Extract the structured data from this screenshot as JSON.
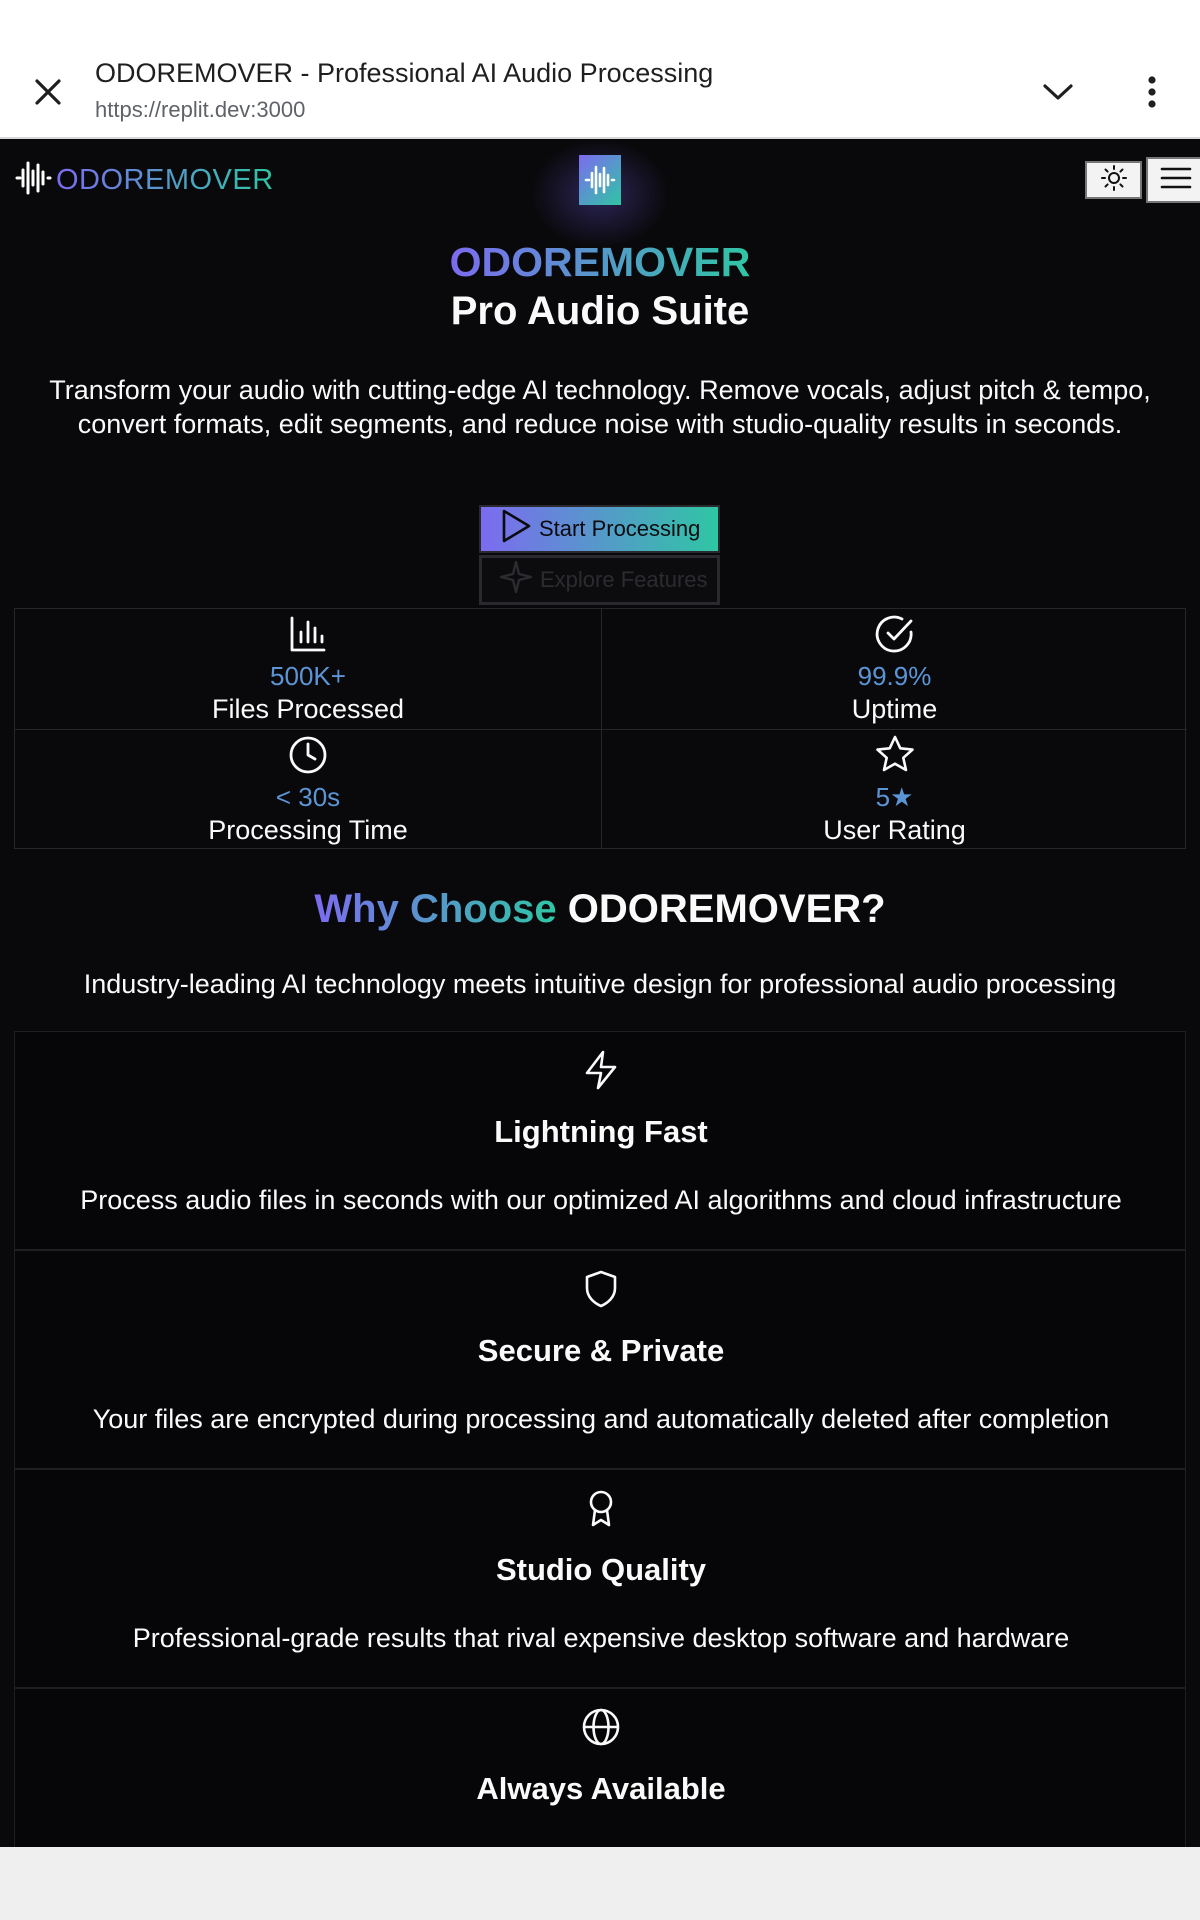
{
  "browser": {
    "title": "ODOREMOVER - Professional AI Audio Processing",
    "url": "https://replit.dev:3000"
  },
  "header": {
    "brand": "ODOREMOVER"
  },
  "hero": {
    "brand": "ODOREMOVER",
    "subtitle": "Pro Audio Suite",
    "description": "Transform your audio with cutting-edge AI technology. Remove vocals, adjust pitch & tempo, convert formats, edit segments, and reduce noise with studio-quality results in seconds.",
    "start_label": "Start Processing",
    "explore_label": "Explore Features"
  },
  "stats": [
    {
      "icon": "bar-chart-icon",
      "value": "500K+",
      "label": "Files Processed"
    },
    {
      "icon": "check-circle-icon",
      "value": "99.9%",
      "label": "Uptime"
    },
    {
      "icon": "clock-icon",
      "value": "< 30s",
      "label": "Processing Time"
    },
    {
      "icon": "star-icon",
      "value": "5★",
      "label": "User Rating"
    }
  ],
  "why": {
    "title_part1": "Why Choose",
    "title_part2": "ODOREMOVER?",
    "subtitle": "Industry-leading AI technology meets intuitive design for professional audio processing"
  },
  "features": [
    {
      "icon": "lightning-icon",
      "title": "Lightning Fast",
      "description": "Process audio files in seconds with our optimized AI algorithms and cloud infrastructure"
    },
    {
      "icon": "shield-icon",
      "title": "Secure & Private",
      "description": "Your files are encrypted during processing and automatically deleted after completion"
    },
    {
      "icon": "award-icon",
      "title": "Studio Quality",
      "description": "Professional-grade results that rival expensive desktop software and hardware"
    },
    {
      "icon": "globe-icon",
      "title": "Always Available",
      "description": ""
    }
  ],
  "colors": {
    "accent_start": "#7c6bf0",
    "accent_end": "#2fc6a4",
    "stat_value": "#5b95d6",
    "background": "#09090b"
  }
}
